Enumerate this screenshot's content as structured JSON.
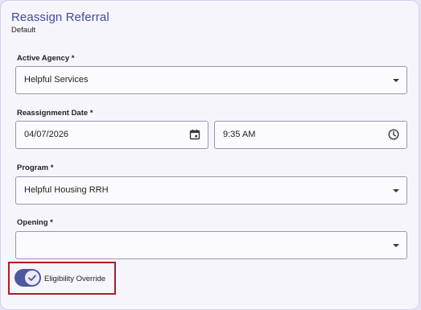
{
  "header": {
    "title": "Reassign Referral",
    "subtitle": "Default"
  },
  "form": {
    "active_agency": {
      "label": "Active Agency *",
      "value": "Helpful Services"
    },
    "reassignment_date": {
      "label": "Reassignment Date *",
      "date": "04/07/2026",
      "time": "9:35 AM"
    },
    "program": {
      "label": "Program *",
      "value": "Helpful Housing RRH"
    },
    "opening": {
      "label": "Opening *",
      "value": ""
    },
    "eligibility_override": {
      "label": "Eligibility Override",
      "checked": true
    }
  },
  "colors": {
    "accent": "#4f579f",
    "title": "#3f4a9c",
    "highlight": "#b01c25"
  },
  "icons": [
    "dropdown-caret-icon",
    "calendar-icon",
    "clock-icon",
    "checkmark-icon"
  ]
}
